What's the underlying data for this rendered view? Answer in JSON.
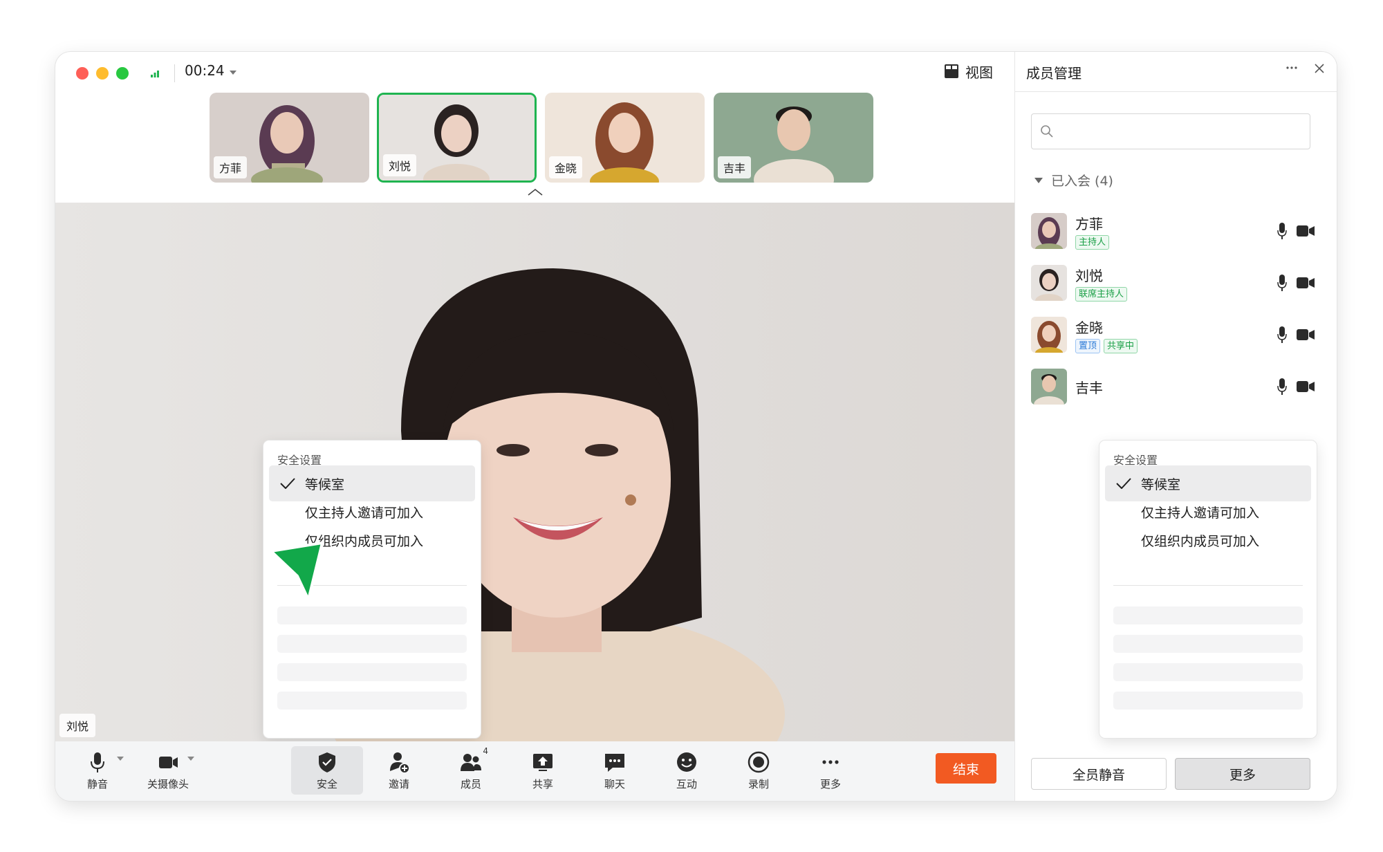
{
  "titlebar": {
    "timer": "00:24",
    "view_label": "视图"
  },
  "thumbnails": [
    {
      "name": "方菲",
      "active": false
    },
    {
      "name": "刘悦",
      "active": true
    },
    {
      "name": "金晓",
      "active": false
    },
    {
      "name": "吉丰",
      "active": false
    }
  ],
  "main_video": {
    "speaker_name": "刘悦"
  },
  "toolbar": {
    "mute_label": "静音",
    "camera_label": "关摄像头",
    "security_label": "安全",
    "invite_label": "邀请",
    "members_label": "成员",
    "members_count": "4",
    "share_label": "共享",
    "chat_label": "聊天",
    "interact_label": "互动",
    "record_label": "录制",
    "more_label": "更多",
    "end_label": "结束"
  },
  "panel": {
    "title": "成员管理",
    "search": {
      "value": "",
      "placeholder": ""
    },
    "group_label": "已入会 (4)",
    "members": [
      {
        "name": "方菲",
        "tags": [
          {
            "text": "主持人",
            "color": "green"
          }
        ]
      },
      {
        "name": "刘悦",
        "tags": [
          {
            "text": "联席主持人",
            "color": "green"
          }
        ]
      },
      {
        "name": "金晓",
        "tags": [
          {
            "text": "置顶",
            "color": "blue"
          },
          {
            "text": "共享中",
            "color": "green"
          }
        ]
      },
      {
        "name": "吉丰",
        "tags": []
      }
    ],
    "mute_all_label": "全员静音",
    "more_label": "更多"
  },
  "security_menu": {
    "title": "安全设置",
    "items": [
      {
        "label": "等候室",
        "checked": true
      },
      {
        "label": "仅主持人邀请可加入",
        "checked": false
      },
      {
        "label": "仅组织内成员可加入",
        "checked": false
      }
    ]
  },
  "colors": {
    "accent_green": "#1fb450",
    "end_button": "#f25a22",
    "tag_blue": "#2b7ad6"
  },
  "icons": [
    "signal-icon",
    "view-grid-icon",
    "chevron-up-icon",
    "microphone-icon",
    "camera-icon",
    "shield-icon",
    "add-user-icon",
    "members-icon",
    "share-screen-icon",
    "chat-icon",
    "emoji-icon",
    "record-icon",
    "more-icon",
    "search-icon",
    "close-icon",
    "check-icon",
    "cursor-arrow-icon"
  ]
}
